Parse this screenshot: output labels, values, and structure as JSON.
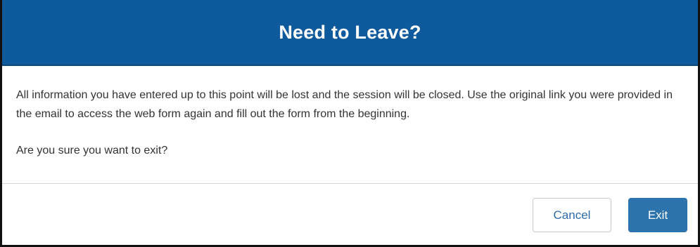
{
  "dialog": {
    "title": "Need to Leave?",
    "message": "All information you have entered up to this point will be lost and the session will be closed. Use the original link you were provided in the email to access the web form again and fill out the form from the beginning.",
    "question": "Are you sure you want to exit?",
    "cancel_label": "Cancel",
    "exit_label": "Exit"
  },
  "colors": {
    "header_bg": "#0e5a9c",
    "primary_button": "#2d73ad",
    "cancel_text": "#2d6ca8"
  }
}
